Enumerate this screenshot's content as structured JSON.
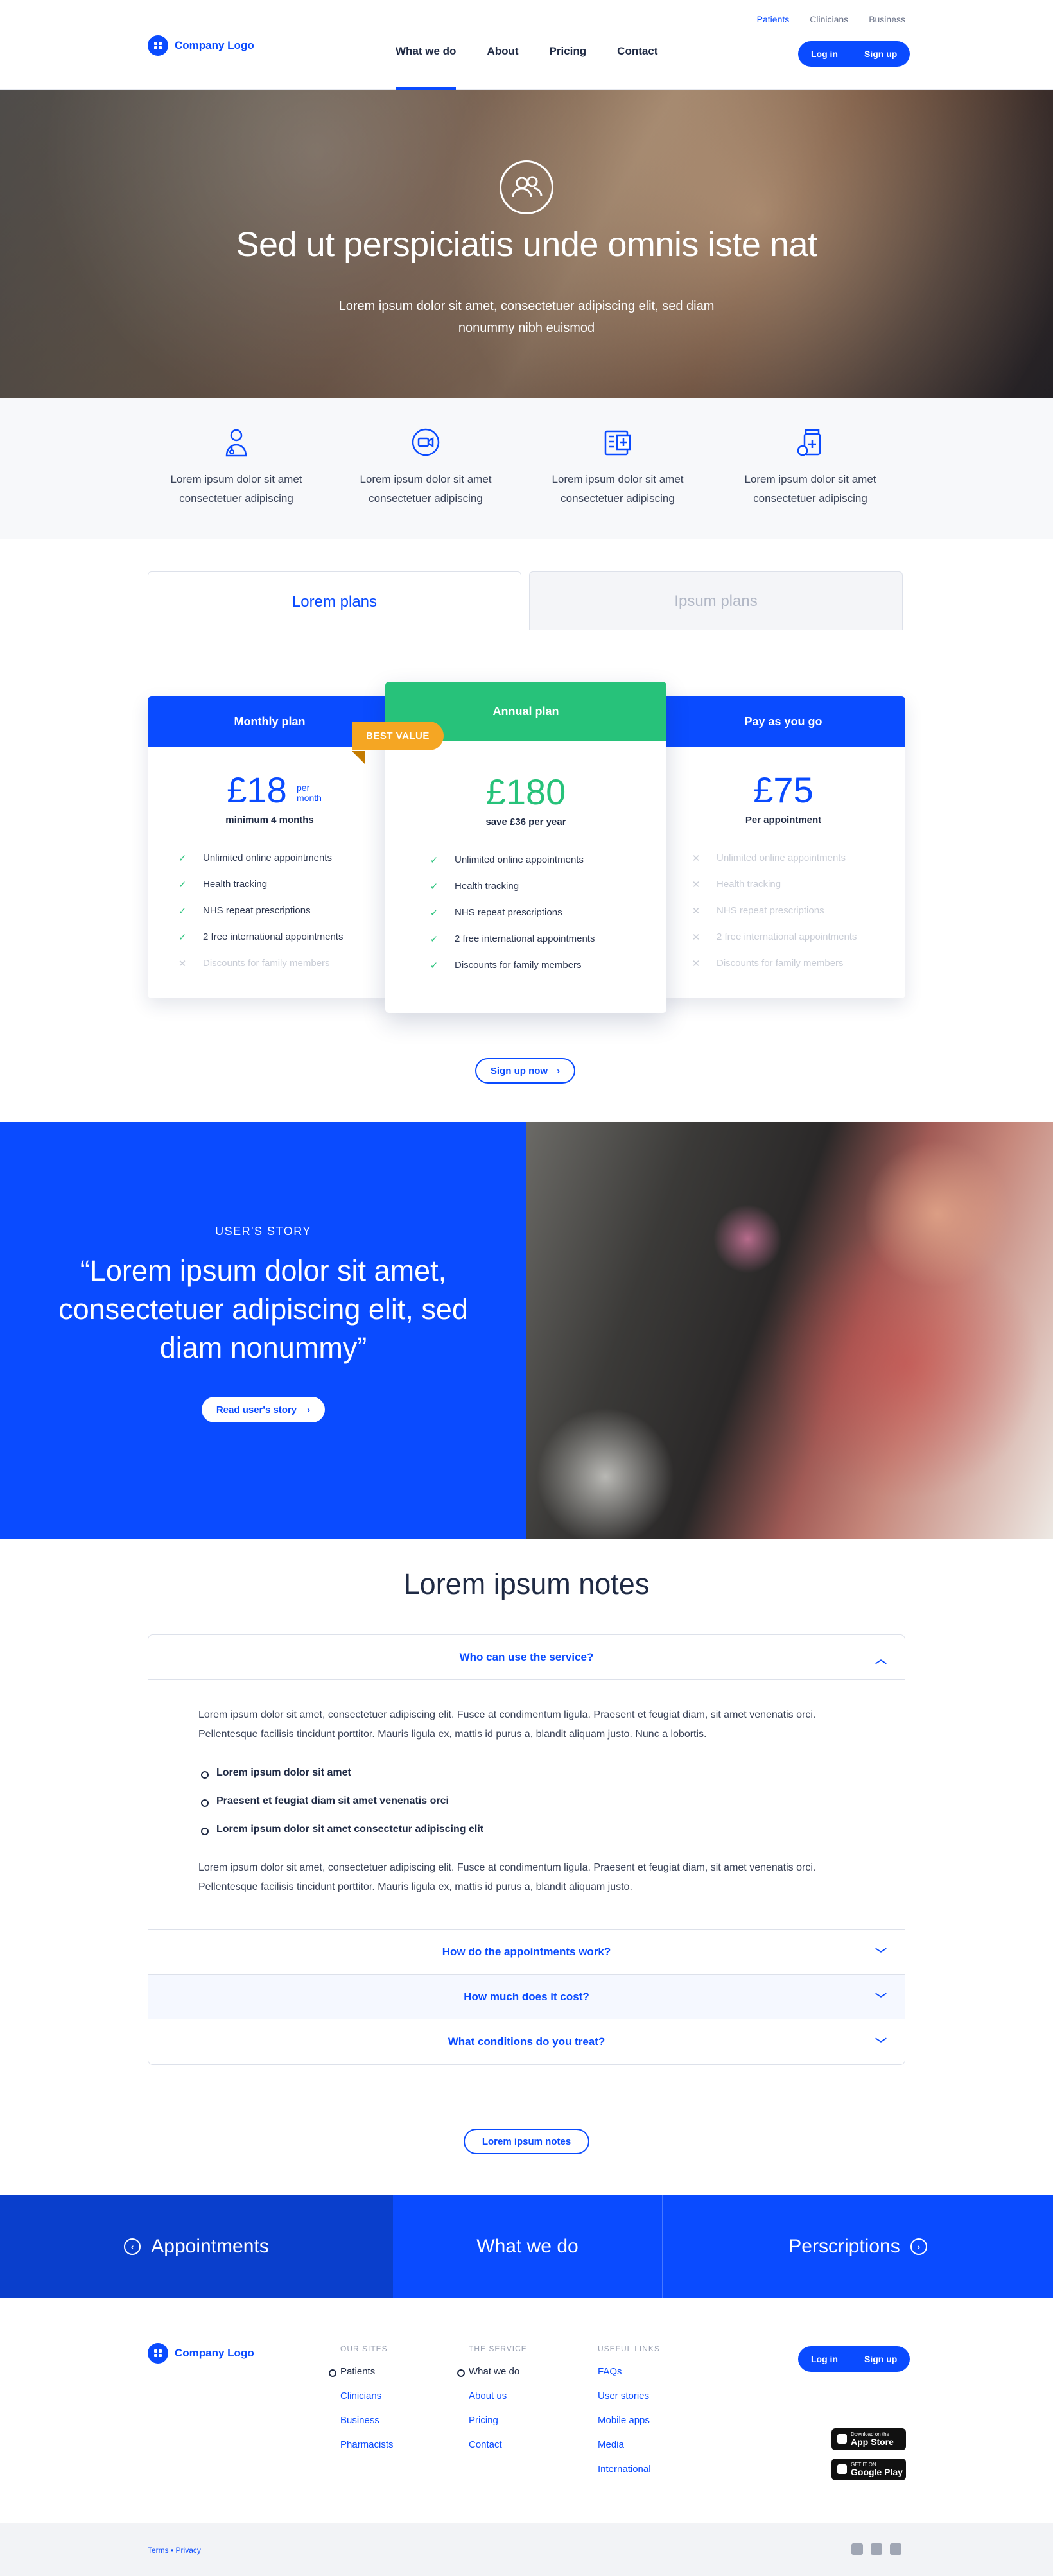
{
  "brand": {
    "logo_text": "Company Logo",
    "accent": "#0a4bff",
    "green": "#27c27a",
    "orange": "#f5a623"
  },
  "util_nav": {
    "patients": "Patients",
    "clinicians": "Clinicians",
    "business": "Business"
  },
  "main_nav": {
    "what_we_do": "What we do",
    "about": "About",
    "pricing": "Pricing",
    "contact": "Contact"
  },
  "auth": {
    "login": "Log in",
    "signup": "Sign up"
  },
  "hero": {
    "title": "Sed ut perspiciatis unde omnis iste nat",
    "subtitle": "Lorem ipsum dolor sit amet, consectetuer adipiscing elit, sed diam nonummy nibh euismod",
    "icon": "users-icon"
  },
  "features": [
    {
      "icon": "doctor-icon",
      "text": "Lorem ipsum dolor sit amet consectetuer adipiscing"
    },
    {
      "icon": "video-call-icon",
      "text": "Lorem ipsum dolor sit amet consectetuer adipiscing"
    },
    {
      "icon": "prescription-icon",
      "text": "Lorem ipsum dolor sit amet consectetuer adipiscing"
    },
    {
      "icon": "medicine-icon",
      "text": "Lorem ipsum dolor sit amet consectetuer adipiscing"
    }
  ],
  "tabs": {
    "lorem": "Lorem plans",
    "ipsum": "Ipsum plans"
  },
  "plans": {
    "monthly": {
      "name": "Monthly plan",
      "price": "£18",
      "per": "per month",
      "note": "minimum 4 months",
      "features": [
        "Unlimited online appointments",
        "Health tracking",
        "NHS repeat prescriptions",
        "2 free international appointments",
        "Discounts for family members"
      ],
      "included": [
        true,
        true,
        true,
        true,
        false
      ]
    },
    "annual": {
      "name": "Annual plan",
      "badge": "BEST VALUE",
      "price": "£180",
      "note": "save £36 per year",
      "features": [
        "Unlimited online appointments",
        "Health tracking",
        "NHS repeat prescriptions",
        "2 free international appointments",
        "Discounts for family members"
      ],
      "included": [
        true,
        true,
        true,
        true,
        true
      ]
    },
    "payg": {
      "name": "Pay as you go",
      "price": "£75",
      "note": "Per appointment",
      "features": [
        "Unlimited online appointments",
        "Health tracking",
        "NHS repeat prescriptions",
        "2 free international appointments",
        "Discounts for family members"
      ],
      "included": [
        false,
        false,
        false,
        false,
        false
      ]
    },
    "cta": "Sign up now"
  },
  "story": {
    "kicker": "USER'S STORY",
    "quote": "“Lorem ipsum dolor sit amet, consectetuer adipiscing elit, sed diam nonummy”",
    "button": "Read user's story"
  },
  "notes": {
    "title": "Lorem ipsum notes",
    "open_question": "Who can use the service?",
    "paragraph1": "Lorem ipsum dolor sit amet, consectetuer adipiscing elit. Fusce at condimentum ligula. Praesent et feugiat diam, sit amet venenatis orci. Pellentesque facilisis tincidunt porttitor. Mauris ligula ex, mattis id purus a, blandit aliquam justo. Nunc a lobortis.",
    "bullets": [
      "Lorem ipsum dolor sit amet",
      "Praesent et feugiat diam sit amet venenatis orci",
      "Lorem ipsum dolor sit amet consectetur adipiscing elit"
    ],
    "paragraph2": "Lorem ipsum dolor sit amet, consectetuer adipiscing elit. Fusce at condimentum ligula. Praesent et feugiat diam, sit amet venenatis orci. Pellentesque facilisis tincidunt porttitor. Mauris ligula ex, mattis id purus a, blandit aliquam justo.",
    "q2": "How do the appointments work?",
    "q3": "How much does it cost?",
    "q4": "What conditions do you treat?",
    "cta": "Lorem ipsum notes"
  },
  "band": {
    "appointments": "Appointments",
    "what_we_do": "What we do",
    "prescriptions": "Perscriptions"
  },
  "footer": {
    "our_sites": {
      "heading": "OUR SITES",
      "links": [
        "Patients",
        "Clinicians",
        "Business",
        "Pharmacists"
      ]
    },
    "the_service": {
      "heading": "THE SERVICE",
      "links": [
        "What we do",
        "About us",
        "Pricing",
        "Contact"
      ]
    },
    "useful_links": {
      "heading": "USEFUL LINKS",
      "links": [
        "FAQs",
        "User stories",
        "Mobile apps",
        "Media",
        "International"
      ]
    },
    "app_store": {
      "small": "Download on the",
      "big": "App Store"
    },
    "google_play": {
      "small": "GET IT ON",
      "big": "Google Play"
    },
    "legal": "Terms • Privacy"
  }
}
